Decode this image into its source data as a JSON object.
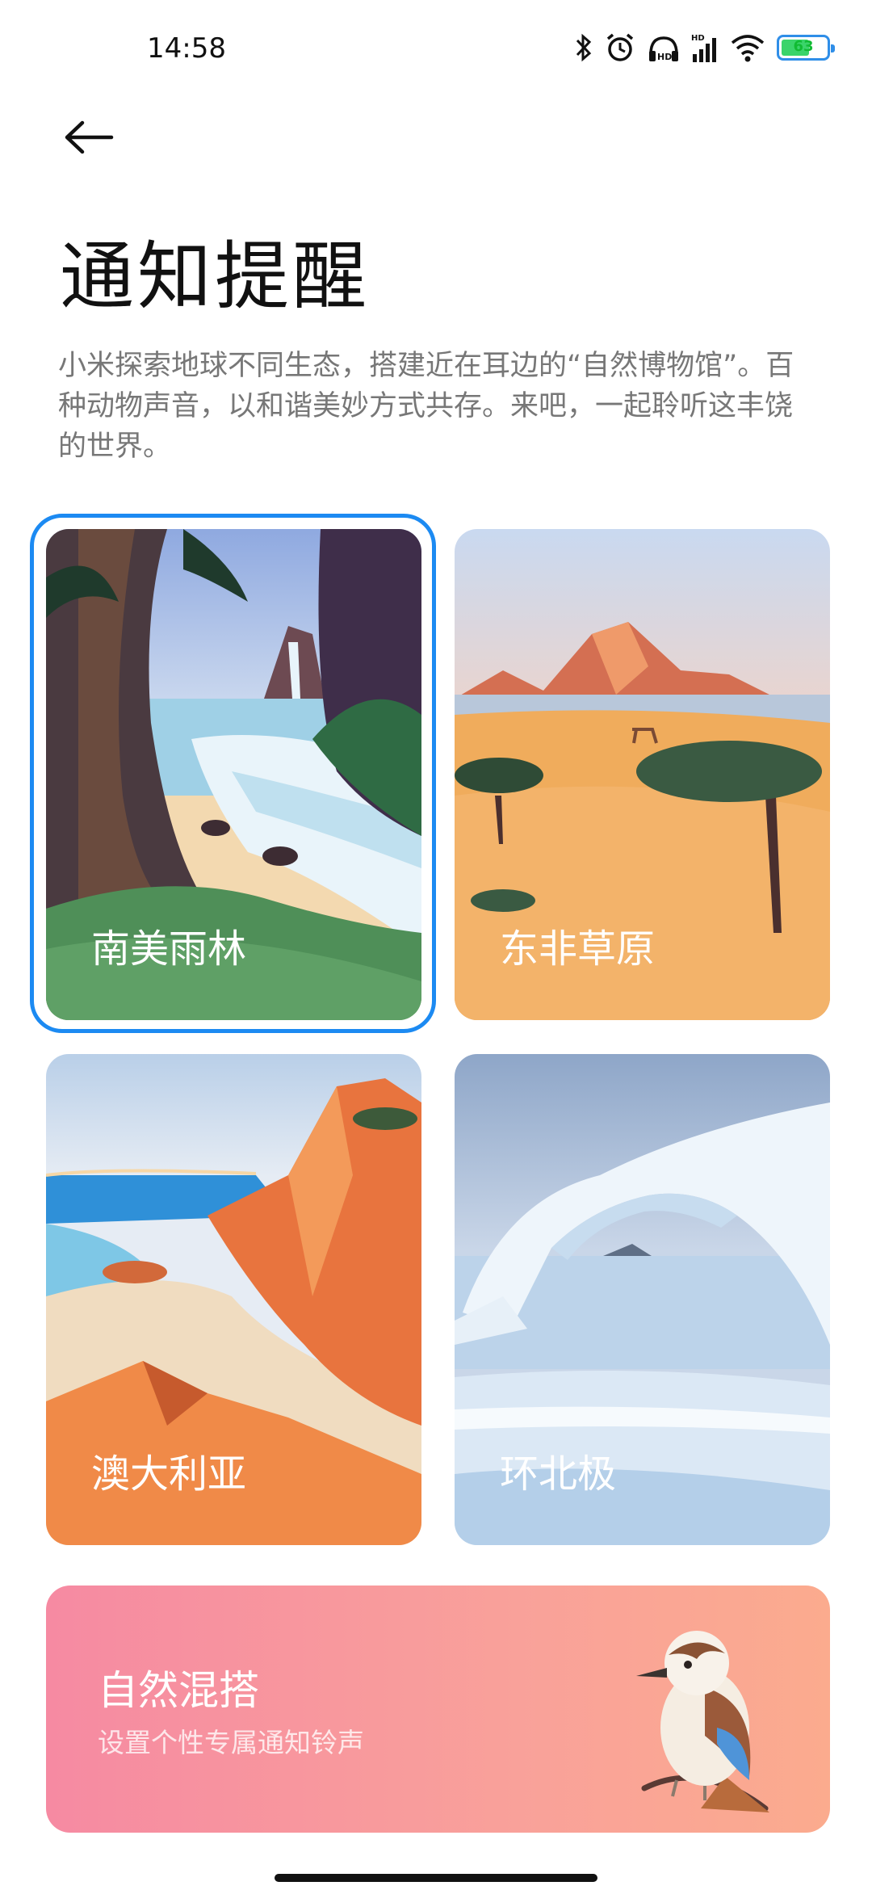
{
  "status_bar": {
    "time": "14:58",
    "battery": "63",
    "battery_level": 0.63,
    "icons": [
      "bluetooth-icon",
      "alarm-icon",
      "hd-icon",
      "signal-icon",
      "wifi-icon",
      "battery-icon"
    ],
    "hd_label": "HD"
  },
  "header": {
    "back_icon": "arrow-left-icon",
    "title": "通知提醒",
    "description": "小米探索地球不同生态，搭建近在耳边的“自然博物馆”。百种动物声音，以和谐美妙方式共存。来吧，一起聆听这丰饶的世界。"
  },
  "themes": [
    {
      "label": "南美雨林",
      "selected": true
    },
    {
      "label": "东非草原",
      "selected": false
    },
    {
      "label": "澳大利亚",
      "selected": false
    },
    {
      "label": "环北极",
      "selected": false
    }
  ],
  "mix": {
    "title": "自然混搭",
    "subtitle": "设置个性专属通知铃声"
  },
  "colors": {
    "accent": "#1c8af2",
    "mix_gradient_start": "#f68aa2",
    "mix_gradient_end": "#fbab8e"
  }
}
